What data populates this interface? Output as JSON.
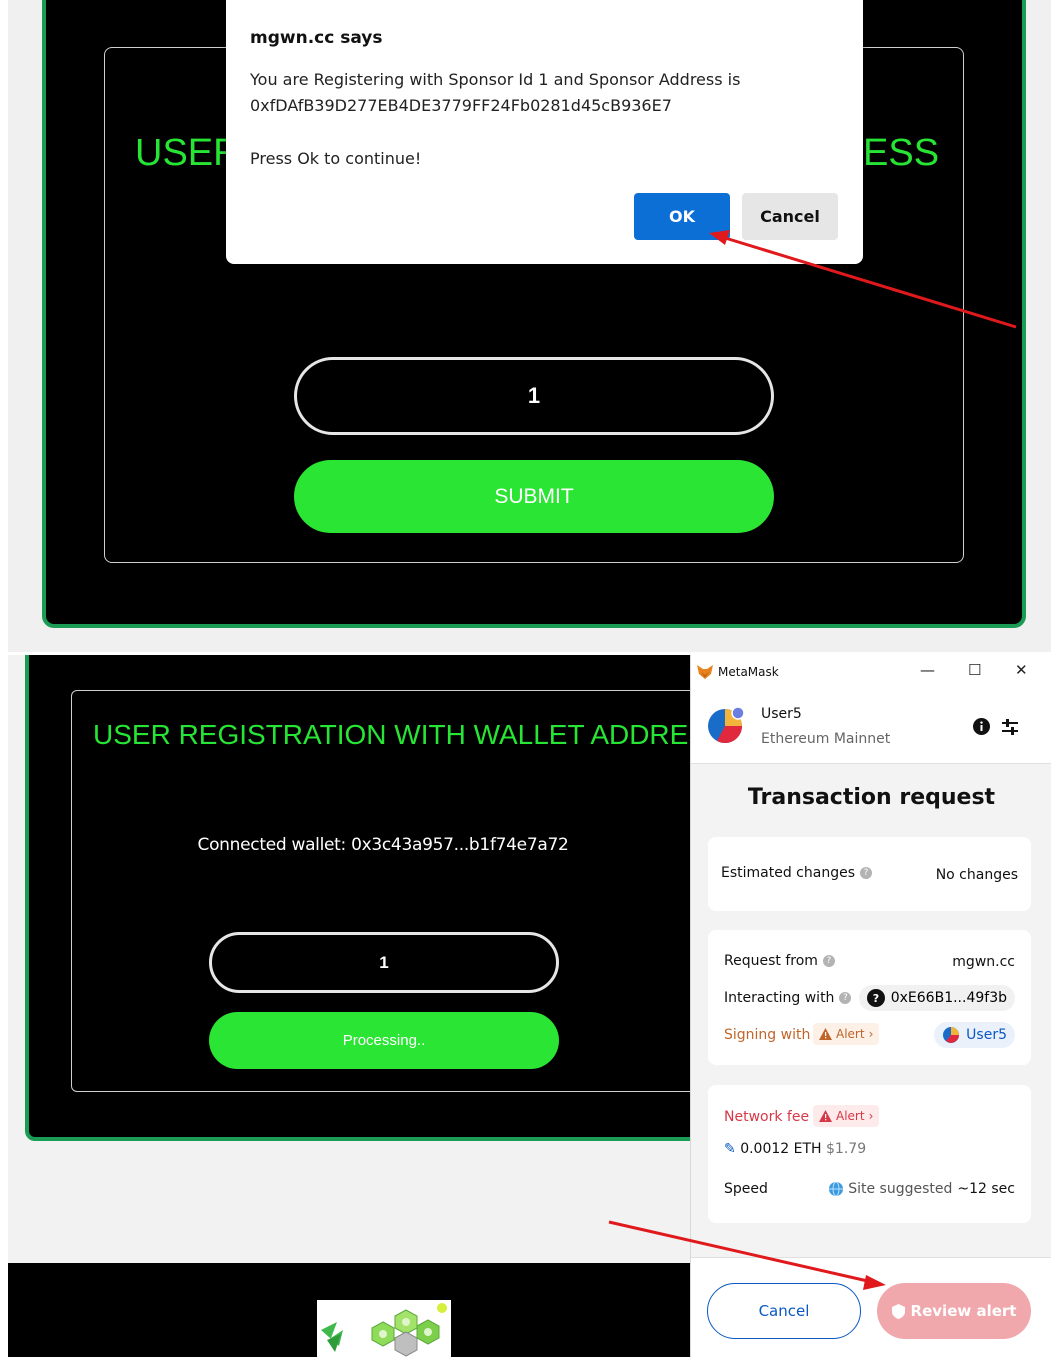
{
  "top": {
    "heading_left": "USER",
    "heading_right": "ESS",
    "input_value": "1",
    "submit_label": "SUBMIT"
  },
  "dialog": {
    "title": "mgwn.cc says",
    "line1": "You are Registering with Sponsor Id 1 and Sponsor Address is",
    "line2": "0xfDAfB39D277EB4DE3779FF24Fb0281d45cB936E7",
    "line3": "Press Ok to continue!",
    "ok_label": "OK",
    "cancel_label": "Cancel"
  },
  "bottom": {
    "heading": "USER REGISTRATION WITH WALLET ADDRESS",
    "connected_wallet": "Connected wallet: 0x3c43a957...b1f74e7a72",
    "input_value": "1",
    "processing_label": "Processing.."
  },
  "metamask": {
    "window_title": "MetaMask",
    "window_controls": {
      "minimize": "—",
      "maximize": "☐",
      "close": "✕"
    },
    "account_name": "User5",
    "network": "Ethereum Mainnet",
    "heading": "Transaction request",
    "estimated_changes_label": "Estimated changes",
    "estimated_changes_value": "No changes",
    "request_from_label": "Request from",
    "request_from_value": "mgwn.cc",
    "interacting_with_label": "Interacting with",
    "interacting_with_value": "0xE66B1...49f3b",
    "signing_with_label": "Signing with",
    "alert_label": "Alert",
    "signing_with_value": "User5",
    "network_fee_label": "Network fee",
    "network_fee_eth": "0.0012 ETH",
    "network_fee_usd": "$1.79",
    "speed_label": "Speed",
    "speed_value": "Site suggested",
    "speed_time": "~12 sec",
    "cancel_label": "Cancel",
    "review_label": "Review alert"
  },
  "colors": {
    "brand_green": "#27e534",
    "card_border": "#1a9c55",
    "dialog_ok": "#0b6fd6",
    "alert_red": "#d73847",
    "link_blue": "#0a58c2",
    "review_button": "#f0a8ad",
    "annotation_arrow": "#e0191d"
  }
}
